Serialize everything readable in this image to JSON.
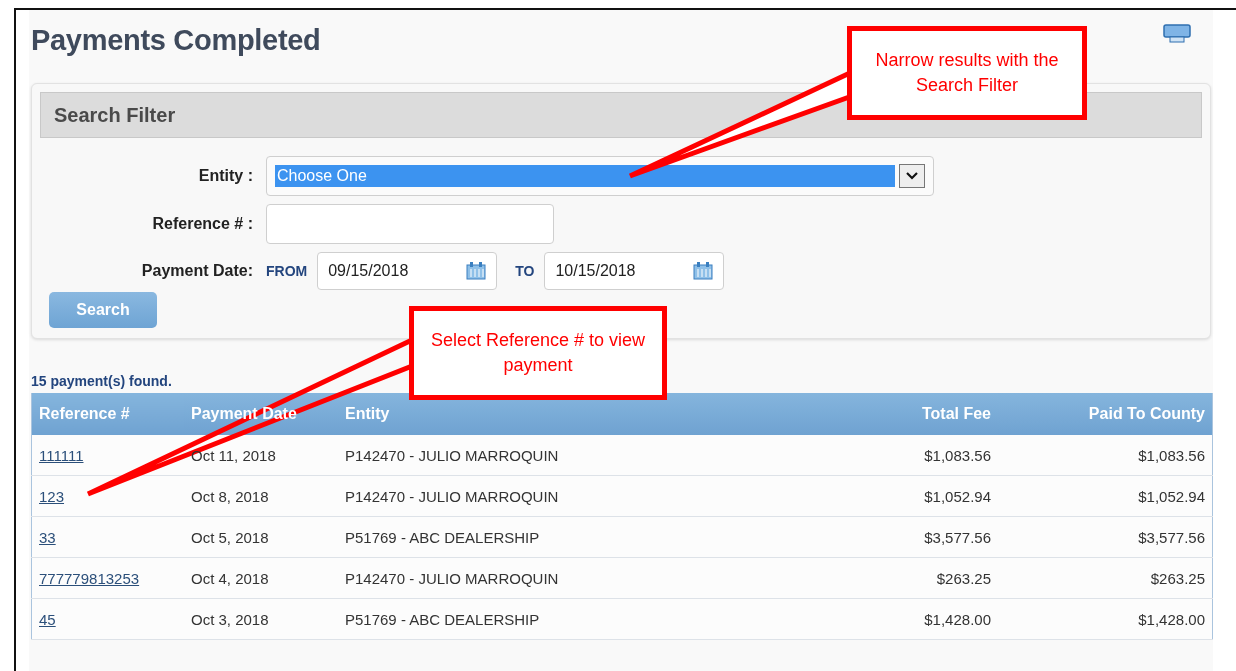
{
  "page": {
    "title": "Payments Completed"
  },
  "search_filter": {
    "title": "Search Filter",
    "entity": {
      "label": "Entity :",
      "value": "Choose One",
      "selected": true
    },
    "reference": {
      "label": "Reference # :"
    },
    "payment_date": {
      "label": "Payment Date:",
      "from_label": "FROM",
      "from_value": "09/15/2018",
      "to_label": "TO",
      "to_value": "10/15/2018"
    },
    "search_button": "Search"
  },
  "results_count": "15 payment(s) found.",
  "table": {
    "columns": [
      "Reference #",
      "Payment Date",
      "Entity",
      "Total Fee",
      "Paid To County"
    ],
    "rows": [
      {
        "reference": "111111",
        "date": "Oct 11, 2018",
        "entity": "P142470 - JULIO MARROQUIN",
        "total_fee": "$1,083.56",
        "paid_to_county": "$1,083.56"
      },
      {
        "reference": "123",
        "date": "Oct 8, 2018",
        "entity": "P142470 - JULIO MARROQUIN",
        "total_fee": "$1,052.94",
        "paid_to_county": "$1,052.94"
      },
      {
        "reference": "33",
        "date": "Oct 5, 2018",
        "entity": "P51769 - ABC DEALERSHIP",
        "total_fee": "$3,577.56",
        "paid_to_county": "$3,577.56"
      },
      {
        "reference": "777779813253",
        "date": "Oct 4, 2018",
        "entity": "P142470 - JULIO MARROQUIN",
        "total_fee": "$263.25",
        "paid_to_county": "$263.25"
      },
      {
        "reference": "45",
        "date": "Oct 3, 2018",
        "entity": "P51769 - ABC DEALERSHIP",
        "total_fee": "$1,428.00",
        "paid_to_county": "$1,428.00"
      }
    ]
  },
  "callouts": [
    {
      "text": "Narrow results with the Search Filter"
    },
    {
      "text": "Select Reference # to view payment"
    }
  ]
}
